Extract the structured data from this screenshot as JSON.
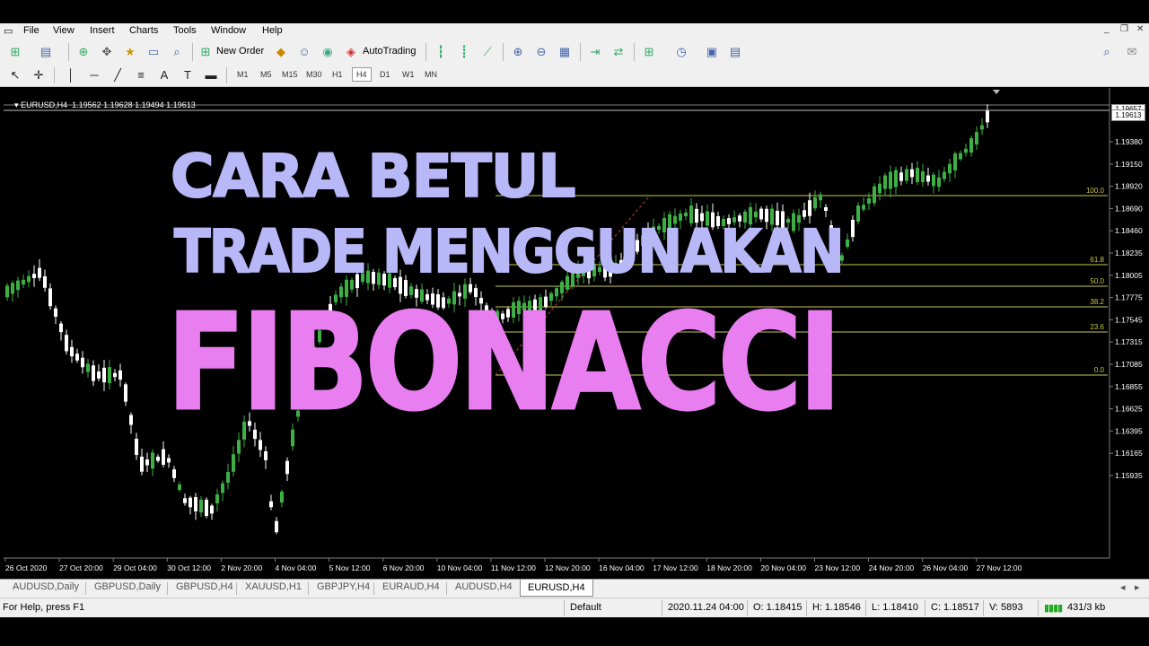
{
  "menu": [
    "File",
    "View",
    "Insert",
    "Charts",
    "Tools",
    "Window",
    "Help"
  ],
  "toolbar": {
    "new_order": "New Order",
    "autotrading": "AutoTrading"
  },
  "timeframes": [
    "M1",
    "M5",
    "M15",
    "M30",
    "H1",
    "H4",
    "D1",
    "W1",
    "MN"
  ],
  "chart": {
    "header": "EURUSD,H4  1.19562 1.19628 1.19494 1.19613",
    "current_price": "1.19613",
    "top_price": "1.19657",
    "price_labels": [
      "1.19380",
      "1.19150",
      "1.18920",
      "1.18690",
      "1.18460",
      "1.18235",
      "1.18005",
      "1.17775",
      "1.17545",
      "1.17315",
      "1.17085",
      "1.16855",
      "1.16625",
      "1.16395",
      "1.16165",
      "1.15935"
    ],
    "time_labels": [
      "26 Oct 2020",
      "27 Oct 20:00",
      "29 Oct 04:00",
      "30 Oct 12:00",
      "2 Nov 20:00",
      "4 Nov 04:00",
      "5 Nov 12:00",
      "6 Nov 20:00",
      "10 Nov 04:00",
      "11 Nov 12:00",
      "12 Nov 20:00",
      "16 Nov 04:00",
      "17 Nov 12:00",
      "18 Nov 20:00",
      "20 Nov 04:00",
      "23 Nov 12:00",
      "24 Nov 20:00",
      "26 Nov 04:00",
      "27 Nov 12:00"
    ],
    "fib_levels": [
      "100.0",
      "61.8",
      "50.0",
      "38.2",
      "23.6",
      "0.0"
    ],
    "colors": {
      "bull": "#3cb043",
      "bear": "#ffffff",
      "fib": "#c8c850",
      "grid": "#808080"
    }
  },
  "overlay": {
    "line1": "CARA BETUL",
    "line2": "TRADE MENGGUNAKAN",
    "line3": "FIBONACCI",
    "color_main": "#b8b8f8",
    "color_accent": "#e87ef0"
  },
  "tabs": [
    "AUDUSD,Daily",
    "GBPUSD,Daily",
    "GBPUSD,H4",
    "XAUUSD,H1",
    "GBPJPY,H4",
    "EURAUD,H4",
    "AUDUSD,H4",
    "EURUSD,H4"
  ],
  "status": {
    "help": "For Help, press F1",
    "profile": "Default",
    "datetime": "2020.11.24 04:00",
    "open": "O: 1.18415",
    "high": "H: 1.18546",
    "low": "L: 1.18410",
    "close": "C: 1.18517",
    "volume": "V: 5893",
    "traffic": "431/3 kb"
  }
}
